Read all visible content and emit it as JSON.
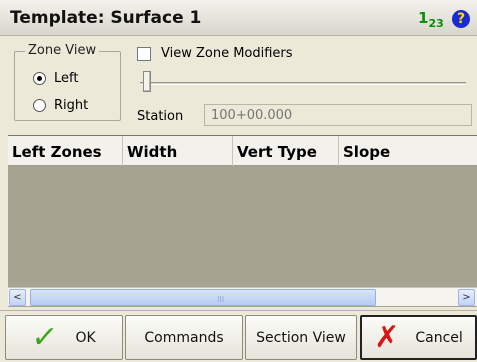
{
  "window": {
    "title": "Template: Surface 1",
    "units_icon": "123",
    "help_icon": "?"
  },
  "zone_view": {
    "legend": "Zone View",
    "options": [
      {
        "label": "Left",
        "checked": true
      },
      {
        "label": "Right",
        "checked": false
      }
    ]
  },
  "view_zone_modifiers": {
    "label": "View Zone Modifiers",
    "checked": false
  },
  "slider": {
    "position": 0
  },
  "station": {
    "label": "Station",
    "placeholder": "100+00.000"
  },
  "table": {
    "columns": [
      "Left Zones",
      "Width",
      "Vert Type",
      "Slope"
    ],
    "rows": []
  },
  "scrollbar": {
    "left_arrow": "<",
    "right_arrow": ">",
    "grip": "III"
  },
  "buttons": {
    "ok_icon": "✓",
    "ok": "OK",
    "commands": "Commands",
    "section_view": "Section View",
    "cancel_icon": "✗",
    "cancel": "Cancel"
  },
  "colors": {
    "grid_background": "#a6a391",
    "ok_check": "#3aa616",
    "cancel_x": "#d91515",
    "units_icon": "#0b8c0b",
    "help_icon": "#1a2ad6"
  }
}
